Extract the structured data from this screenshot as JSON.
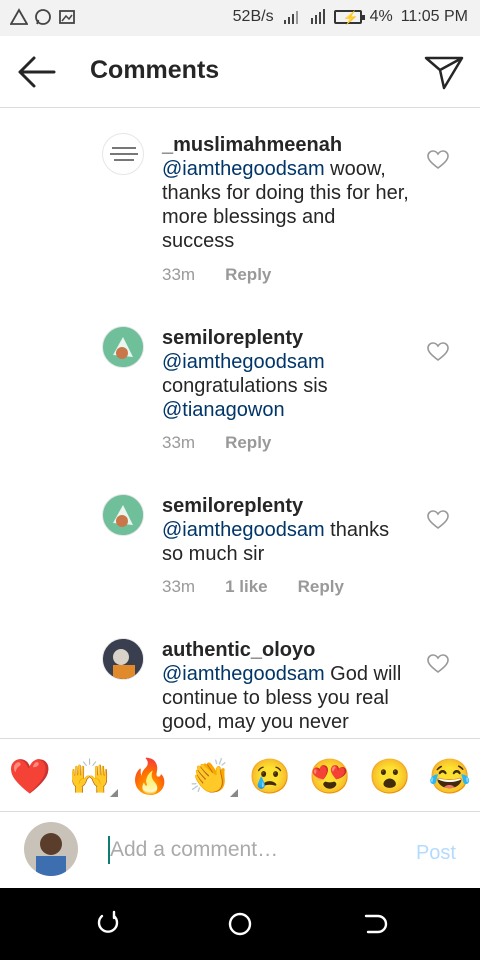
{
  "status_bar": {
    "speed": "52B/s",
    "battery": "4%",
    "time": "11:05 PM",
    "icons": [
      "alert-icon",
      "whatsapp-icon",
      "gallery-icon",
      "signal-icon",
      "data-icon",
      "battery-icon"
    ]
  },
  "header": {
    "title": "Comments",
    "back_icon": "arrow-left-icon",
    "send_icon": "paper-plane-icon"
  },
  "comments": [
    {
      "username": "_muslimahmeenah",
      "mention": "@iamthegoodsam",
      "text": " woow, thanks for doing this for her, more blessings and success",
      "time": "33m",
      "likes": "",
      "reply": "Reply"
    },
    {
      "username": "semiloreplenty",
      "mention": "@iamthegoodsam",
      "text": " congratulations sis ",
      "mention2": "@tianagowon",
      "time": "33m",
      "likes": "",
      "reply": "Reply"
    },
    {
      "username": "semiloreplenty",
      "mention": "@iamthegoodsam",
      "text": " thanks so much sir",
      "time": "33m",
      "likes": "1 like",
      "reply": "Reply"
    },
    {
      "username": "authentic_oloyo",
      "mention": "@iamthegoodsam",
      "text": " God will continue to bless you real good,  may you never",
      "time": "",
      "likes": "",
      "reply": ""
    }
  ],
  "emojis": [
    {
      "char": "❤️",
      "name": "red-heart-emoji"
    },
    {
      "char": "🙌",
      "name": "raising-hands-emoji"
    },
    {
      "char": "🔥",
      "name": "fire-emoji"
    },
    {
      "char": "👏",
      "name": "clapping-hands-emoji"
    },
    {
      "char": "😢",
      "name": "crying-face-emoji"
    },
    {
      "char": "😍",
      "name": "heart-eyes-emoji"
    },
    {
      "char": "😮",
      "name": "surprised-face-emoji"
    },
    {
      "char": "😂",
      "name": "tears-of-joy-emoji"
    }
  ],
  "input": {
    "placeholder": "Add a comment…",
    "post_label": "Post"
  },
  "colors": {
    "mention": "#003569",
    "post_disabled": "#b3dbff",
    "meta": "#999999"
  }
}
